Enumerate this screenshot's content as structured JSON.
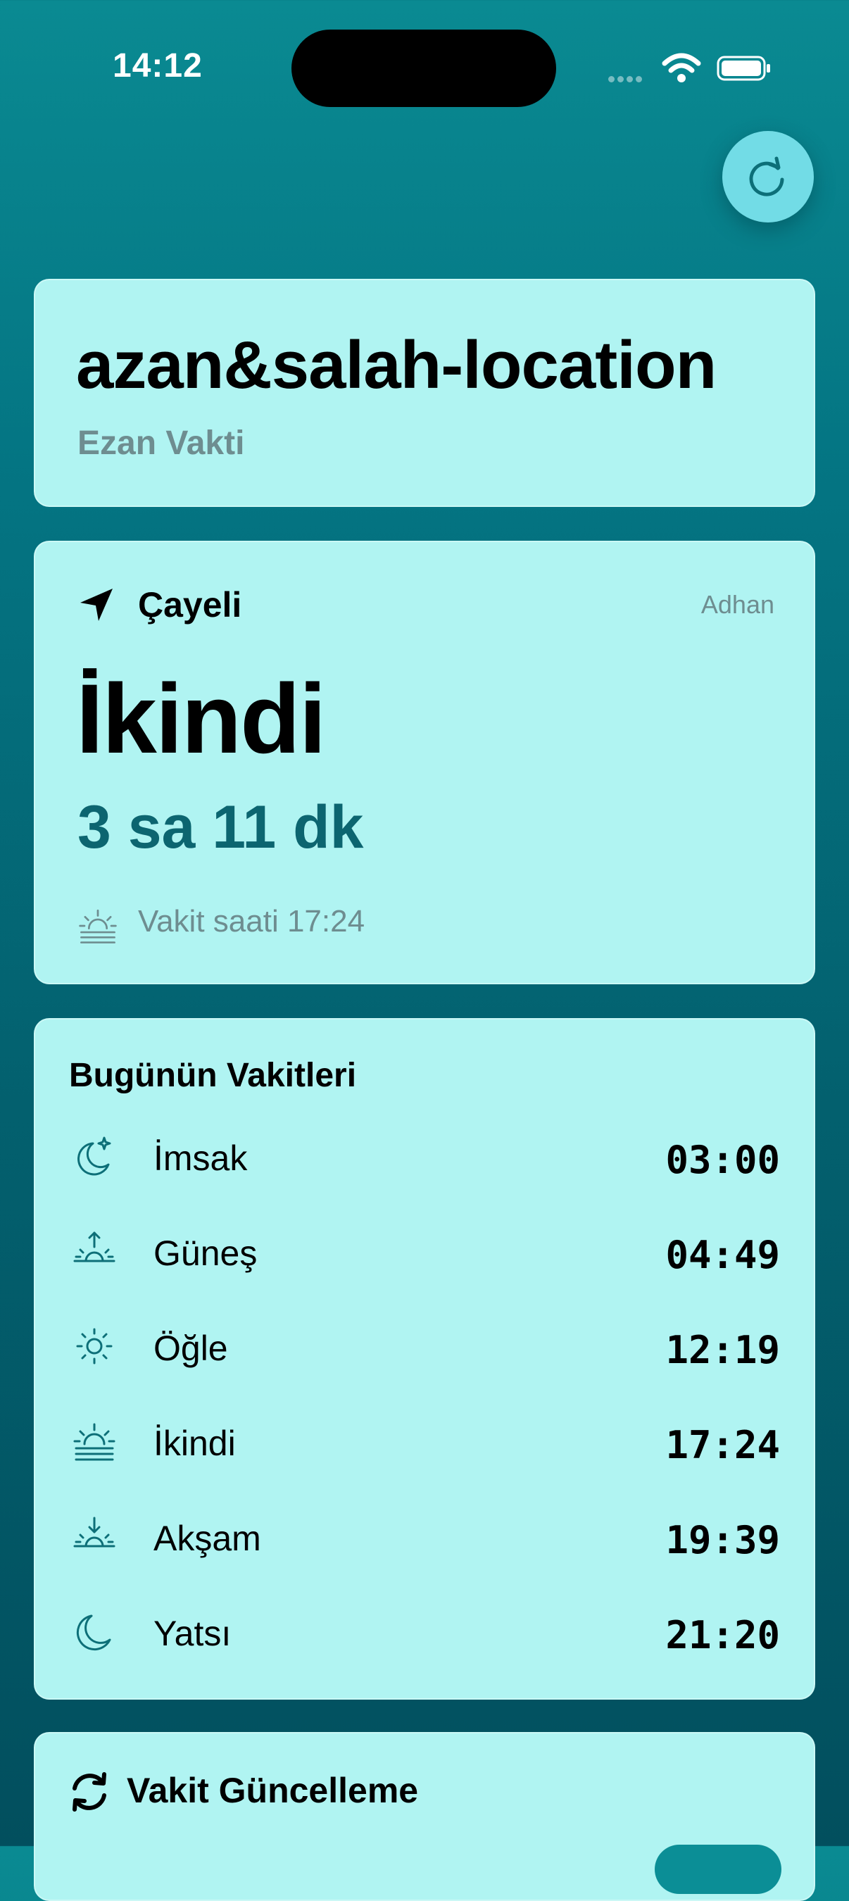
{
  "status_bar": {
    "time": "14:12"
  },
  "header": {
    "refresh_icon": "refresh-icon"
  },
  "app_card": {
    "title": "azan&salah-location",
    "subtitle": "Ezan Vakti"
  },
  "next_prayer": {
    "location": "Çayeli",
    "source": "Adhan",
    "name": "İkindi",
    "countdown": "3 sa 11 dk",
    "time_label": "Vakit saati 17:24"
  },
  "today": {
    "title": "Bugünün Vakitleri",
    "prayers": [
      {
        "name": "İmsak",
        "time": "03:00",
        "icon": "moon-stars-icon"
      },
      {
        "name": "Güneş",
        "time": "04:49",
        "icon": "sunrise-icon"
      },
      {
        "name": "Öğle",
        "time": "12:19",
        "icon": "sun-icon"
      },
      {
        "name": "İkindi",
        "time": "17:24",
        "icon": "sun-haze-icon"
      },
      {
        "name": "Akşam",
        "time": "19:39",
        "icon": "sunset-icon"
      },
      {
        "name": "Yatsı",
        "time": "21:20",
        "icon": "moon-icon"
      }
    ]
  },
  "update": {
    "title": "Vakit Güncelleme",
    "toggle_on": true
  },
  "colors": {
    "accent": "#0c6570",
    "card": "#b0f4f2",
    "background": "#03606e",
    "icon": "#0d6f78"
  }
}
